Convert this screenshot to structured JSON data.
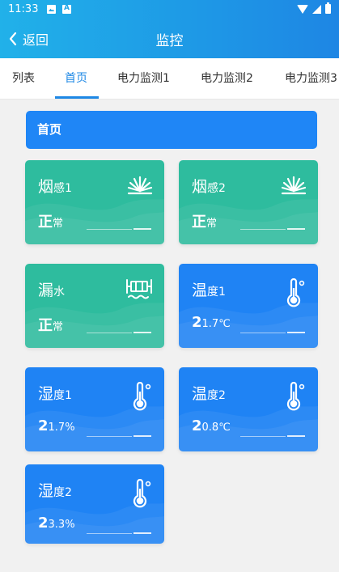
{
  "status": {
    "time": "11:33"
  },
  "header": {
    "back_label": "返回",
    "title": "监控"
  },
  "tabs": [
    {
      "label": "列表"
    },
    {
      "label": "首页",
      "active": true
    },
    {
      "label": "电力监测1"
    },
    {
      "label": "电力监测2"
    },
    {
      "label": "电力监测3"
    }
  ],
  "section": {
    "title": "首页"
  },
  "cards": [
    {
      "name": "烟",
      "name_sub": "感1",
      "value": "正",
      "value_sub": "常",
      "icon": "smoke-sensor-icon",
      "color": "#2ebc9e"
    },
    {
      "name": "烟",
      "name_sub": "感2",
      "value": "正",
      "value_sub": "常",
      "icon": "smoke-sensor-icon",
      "color": "#2ebc9e"
    },
    {
      "name": "漏",
      "name_sub": "水",
      "value": "正",
      "value_sub": "常",
      "icon": "water-leak-icon",
      "color": "#2ebc9e"
    },
    {
      "name": "温",
      "name_sub": "度1",
      "value": "2",
      "value_sub": "1.7℃",
      "icon": "thermometer-icon",
      "color": "#1f83f4"
    },
    {
      "name": "湿",
      "name_sub": "度1",
      "value": "2",
      "value_sub": "1.7%",
      "icon": "thermometer-icon",
      "color": "#1f83f4"
    },
    {
      "name": "温",
      "name_sub": "度2",
      "value": "2",
      "value_sub": "0.8℃",
      "icon": "thermometer-icon",
      "color": "#1f83f4"
    },
    {
      "name": "湿",
      "name_sub": "度2",
      "value": "2",
      "value_sub": "3.3%",
      "icon": "thermometer-icon",
      "color": "#1f83f4"
    }
  ]
}
